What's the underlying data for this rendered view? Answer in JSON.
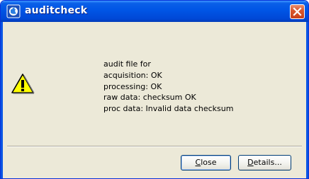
{
  "window": {
    "title": "auditcheck",
    "icon": "app-globe-icon",
    "close_icon": "close-icon"
  },
  "message": {
    "icon": "warning-icon",
    "lines": [
      "audit file for",
      "acquisition: OK",
      "processing: OK",
      "raw data: checksum OK",
      "proc data: Invalid data checksum"
    ]
  },
  "buttons": {
    "close": {
      "mnemonic": "C",
      "rest": "lose"
    },
    "details": {
      "mnemonic": "D",
      "rest": "etails..."
    }
  },
  "colors": {
    "titlebar": "#0055e5",
    "dialog_bg": "#ece9d8",
    "close_button": "#d9582e",
    "warning_yellow": "#ffff00"
  }
}
